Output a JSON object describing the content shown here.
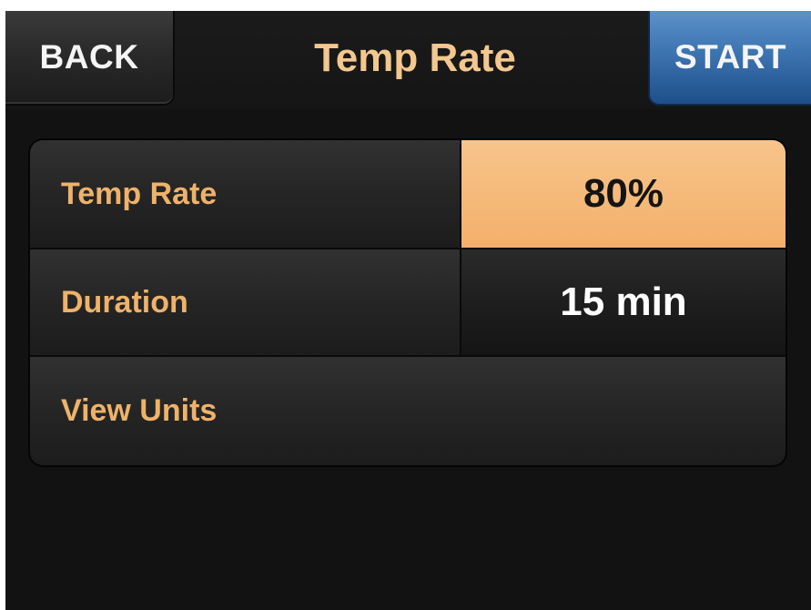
{
  "header": {
    "back_label": "BACK",
    "title": "Temp Rate",
    "start_label": "START"
  },
  "settings": {
    "rows": [
      {
        "label": "Temp Rate",
        "value": "80%",
        "selected": true
      },
      {
        "label": "Duration",
        "value": "15 min",
        "selected": false
      },
      {
        "label": "View Units"
      }
    ]
  },
  "colors": {
    "label_text": "#eeb26a",
    "title_text": "#f3c78e",
    "selected_fill": "#f3b06b",
    "start_button": "#3c74b1",
    "background": "#121212"
  }
}
